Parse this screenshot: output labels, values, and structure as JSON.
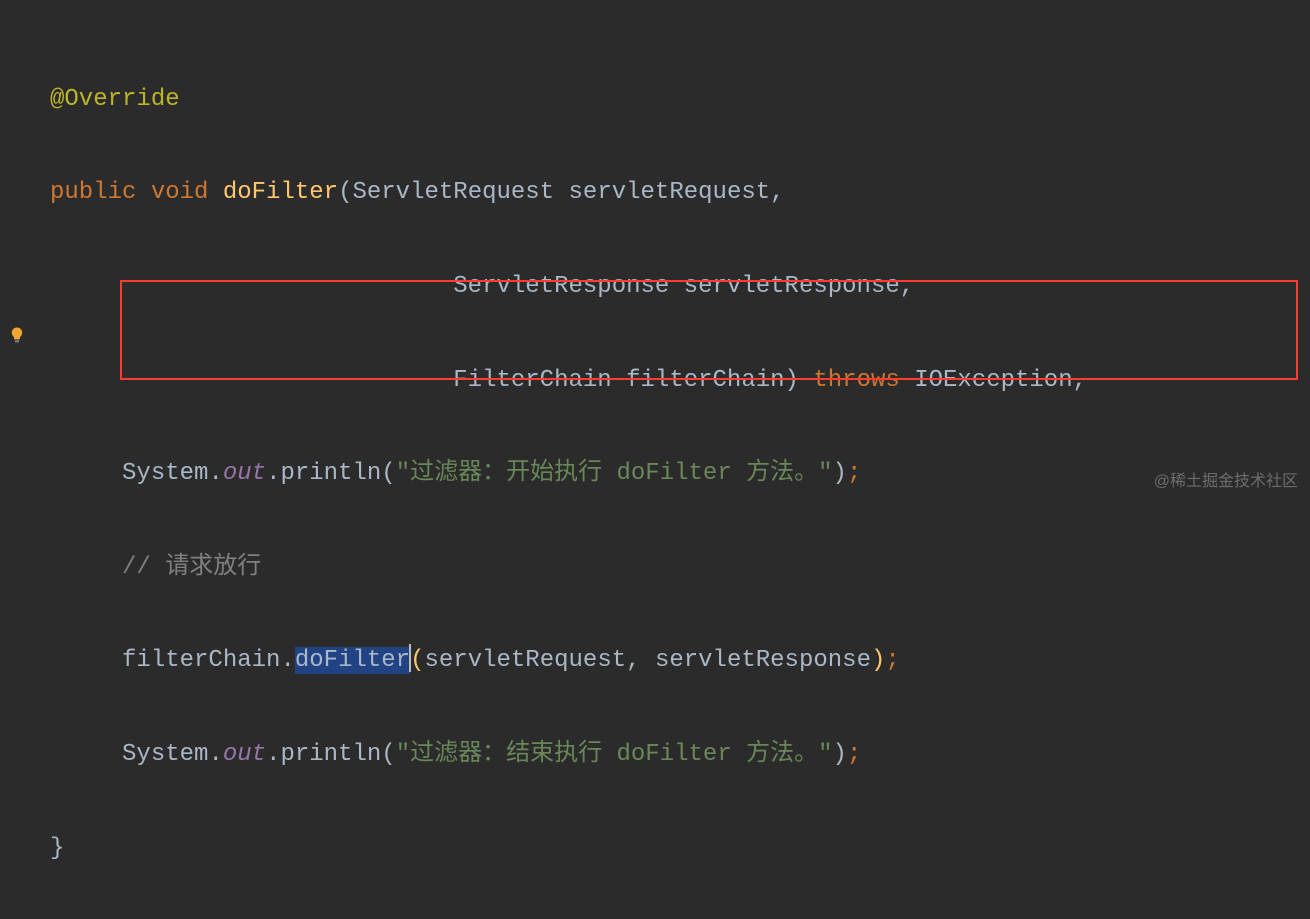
{
  "code": {
    "line1": {
      "annotation": "@Override"
    },
    "line2": {
      "kw_public": "public",
      "kw_void": "void",
      "method": "doFilter",
      "paren_open": "(",
      "type1": "ServletRequest",
      "param1": "servletRequest",
      "comma": ","
    },
    "line3": {
      "type2": "ServletResponse",
      "param2": "servletResponse",
      "comma": ","
    },
    "line4": {
      "type3": "FilterChain",
      "param3": "filterChain",
      "paren_close": ")",
      "kw_throws": "throws",
      "exc1": "IOException",
      "comma": ","
    },
    "line5": {
      "class": "System",
      "dot1": ".",
      "field": "out",
      "dot2": ".",
      "method": "println",
      "paren_open": "(",
      "str": "\"过滤器：开始执行 doFilter 方法。\"",
      "paren_close": ")",
      "semi": ";"
    },
    "line6": {
      "comment": "// 请求放行"
    },
    "line7": {
      "obj": "filterChain",
      "dot": ".",
      "method": "doFilter",
      "paren_open": "(",
      "arg1": "servletRequest",
      "comma": ",",
      "arg2": "servletResponse",
      "paren_close": ")",
      "semi": ";"
    },
    "line8": {
      "class": "System",
      "dot1": ".",
      "field": "out",
      "dot2": ".",
      "method": "println",
      "paren_open": "(",
      "str": "\"过滤器：结束执行 doFilter 方法。\"",
      "paren_close": ")",
      "semi": ";"
    },
    "line9": {
      "brace": "}"
    }
  },
  "watermark": "@稀土掘金技术社区"
}
